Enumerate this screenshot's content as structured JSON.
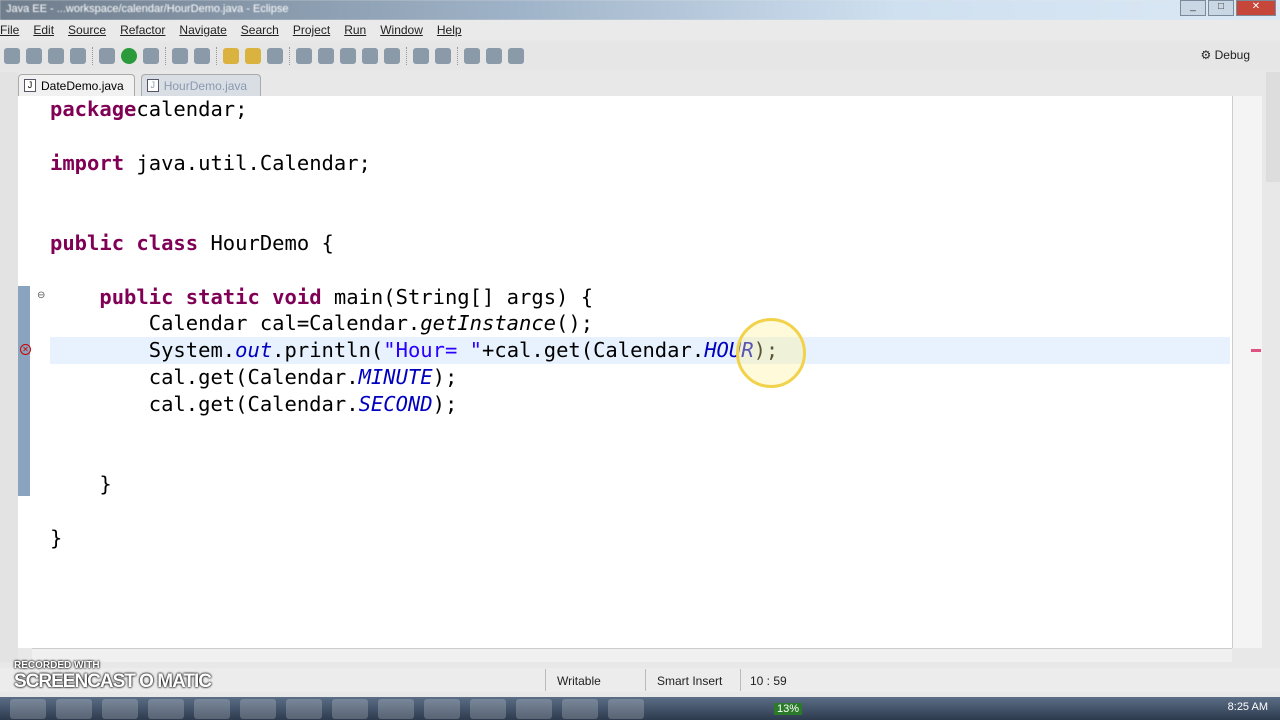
{
  "window": {
    "title": "Java EE - ...workspace/calendar/HourDemo.java - Eclipse"
  },
  "menu": [
    "File",
    "Edit",
    "Source",
    "Refactor",
    "Navigate",
    "Search",
    "Project",
    "Run",
    "Window",
    "Help"
  ],
  "perspective": "Debug",
  "tabs": [
    {
      "label": "DateDemo.java",
      "active": false
    },
    {
      "label": "HourDemo.java",
      "active": true
    }
  ],
  "code": [
    [
      [
        "kw",
        "package"
      ],
      [
        "",
        "calendar;"
      ]
    ],
    [],
    [
      [
        "kw",
        "import"
      ],
      [
        "",
        " java.util.Calendar;"
      ]
    ],
    [],
    [],
    [
      [
        "kw",
        "public class"
      ],
      [
        "",
        " HourDemo {"
      ]
    ],
    [],
    [
      [
        "",
        "    "
      ],
      [
        "kw",
        "public static void"
      ],
      [
        "",
        " main(String[] args) {"
      ]
    ],
    [
      [
        "",
        "        Calendar cal=Calendar."
      ],
      [
        "it",
        "getInstance"
      ],
      [
        "",
        "();"
      ]
    ],
    [
      [
        "",
        "        System."
      ],
      [
        "fld",
        "out"
      ],
      [
        "",
        ".println("
      ],
      [
        "str",
        "\"Hour= \""
      ],
      [
        "",
        "+cal.get(Calendar."
      ],
      [
        "fld",
        "HOUR"
      ],
      [
        "",
        ");"
      ]
    ],
    [
      [
        "",
        "        cal.get(Calendar."
      ],
      [
        "fld",
        "MINUTE"
      ],
      [
        "",
        ");"
      ]
    ],
    [
      [
        "",
        "        cal.get(Calendar."
      ],
      [
        "fld",
        "SECOND"
      ],
      [
        "",
        ");"
      ]
    ],
    [],
    [],
    [
      [
        "",
        "    }"
      ]
    ],
    [],
    [
      [
        "",
        "}"
      ]
    ]
  ],
  "current_line": 9,
  "status": {
    "mode": "Writable",
    "insert": "Smart Insert",
    "position": "10 : 59"
  },
  "watermark": {
    "top": "RECORDED WITH",
    "brand": "SCREENCAST O MATIC"
  },
  "clock": "8:25 AM",
  "battery": "13%"
}
